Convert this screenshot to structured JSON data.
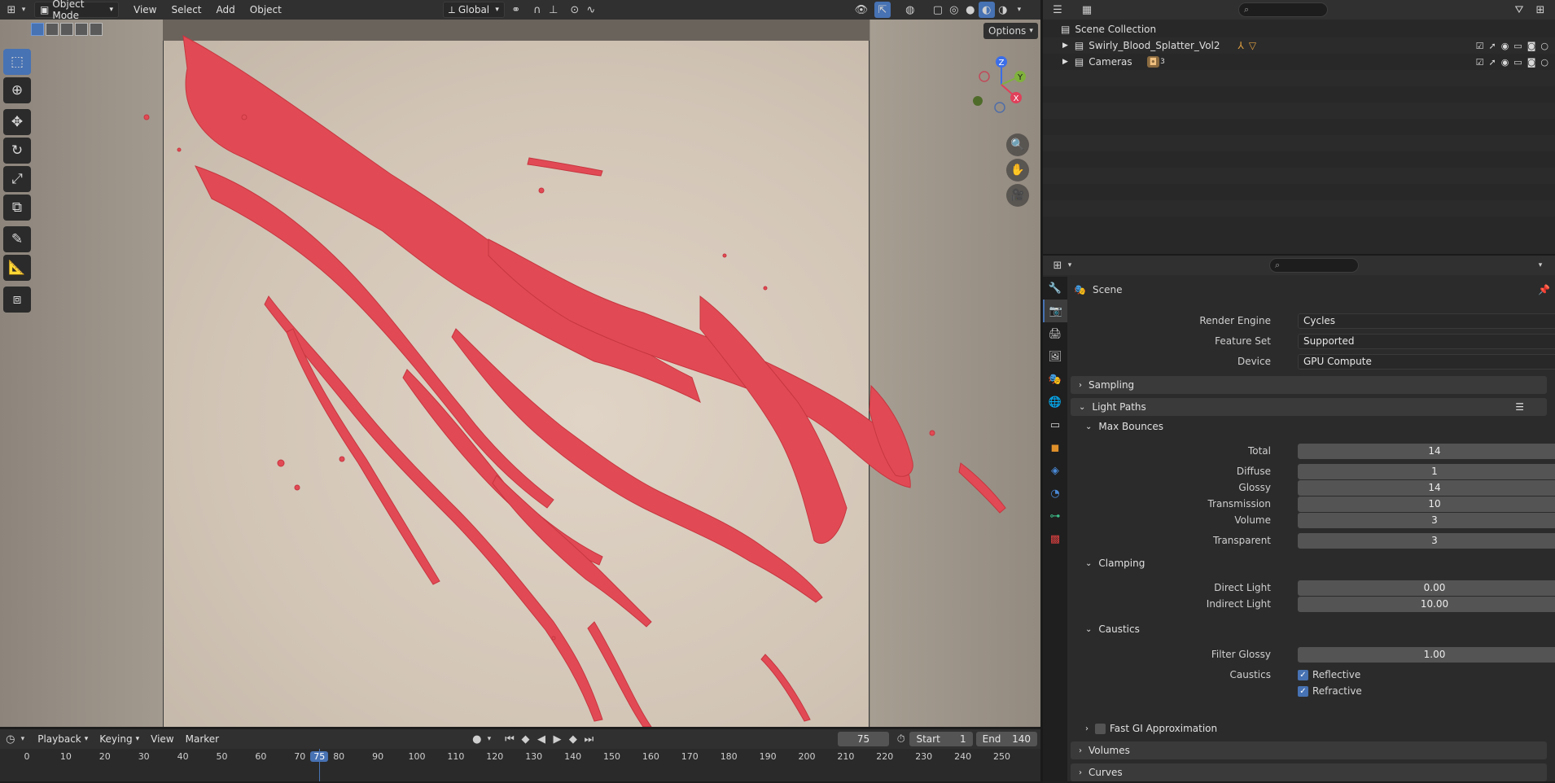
{
  "header": {
    "editor_icon": "editor-type-icon",
    "mode": "Object Mode",
    "menus": [
      "View",
      "Select",
      "Add",
      "Object"
    ],
    "transform_orientation": "Global",
    "options_label": "Options"
  },
  "viewport": {
    "splatter_color": "#e14a54",
    "gizmo": {
      "z": "Z",
      "y": "Y",
      "x": "X"
    }
  },
  "outliner": {
    "search_placeholder": "",
    "root": "Scene Collection",
    "items": [
      {
        "label": "Swirly_Blood_Splatter_Vol2"
      },
      {
        "label": "Cameras",
        "badge": "3"
      }
    ]
  },
  "properties": {
    "search_placeholder": "",
    "context": "Scene",
    "render_engine_label": "Render Engine",
    "render_engine": "Cycles",
    "feature_set_label": "Feature Set",
    "feature_set": "Supported",
    "device_label": "Device",
    "device": "GPU Compute",
    "panels": {
      "sampling": "Sampling",
      "light_paths": "Light Paths",
      "max_bounces": "Max Bounces",
      "clamping": "Clamping",
      "caustics": "Caustics",
      "fast_gi": "Fast GI Approximation",
      "volumes": "Volumes",
      "curves": "Curves"
    },
    "bounces": [
      {
        "label": "Total",
        "value": "14"
      },
      {
        "label": "Diffuse",
        "value": "1"
      },
      {
        "label": "Glossy",
        "value": "14"
      },
      {
        "label": "Transmission",
        "value": "10"
      },
      {
        "label": "Volume",
        "value": "3"
      },
      {
        "label": "Transparent",
        "value": "3"
      }
    ],
    "clamping": [
      {
        "label": "Direct Light",
        "value": "0.00"
      },
      {
        "label": "Indirect Light",
        "value": "10.00"
      }
    ],
    "caustics": {
      "filter_glossy_label": "Filter Glossy",
      "filter_glossy": "1.00",
      "caustics_label": "Caustics",
      "reflective": "Reflective",
      "refractive": "Refractive"
    }
  },
  "timeline": {
    "menus": [
      "Playback",
      "Keying",
      "View",
      "Marker"
    ],
    "current_frame": "75",
    "start_label": "Start",
    "start": "1",
    "end_label": "End",
    "end": "140",
    "ruler": [
      "0",
      "10",
      "20",
      "30",
      "40",
      "50",
      "60",
      "70",
      "75",
      "80",
      "90",
      "100",
      "110",
      "120",
      "130",
      "140",
      "150",
      "160",
      "170",
      "180",
      "190",
      "200",
      "210",
      "220",
      "230",
      "240",
      "250"
    ]
  },
  "colors": {
    "accent": "#4772b3",
    "panel": "#2b2b2b",
    "header": "#303030"
  }
}
